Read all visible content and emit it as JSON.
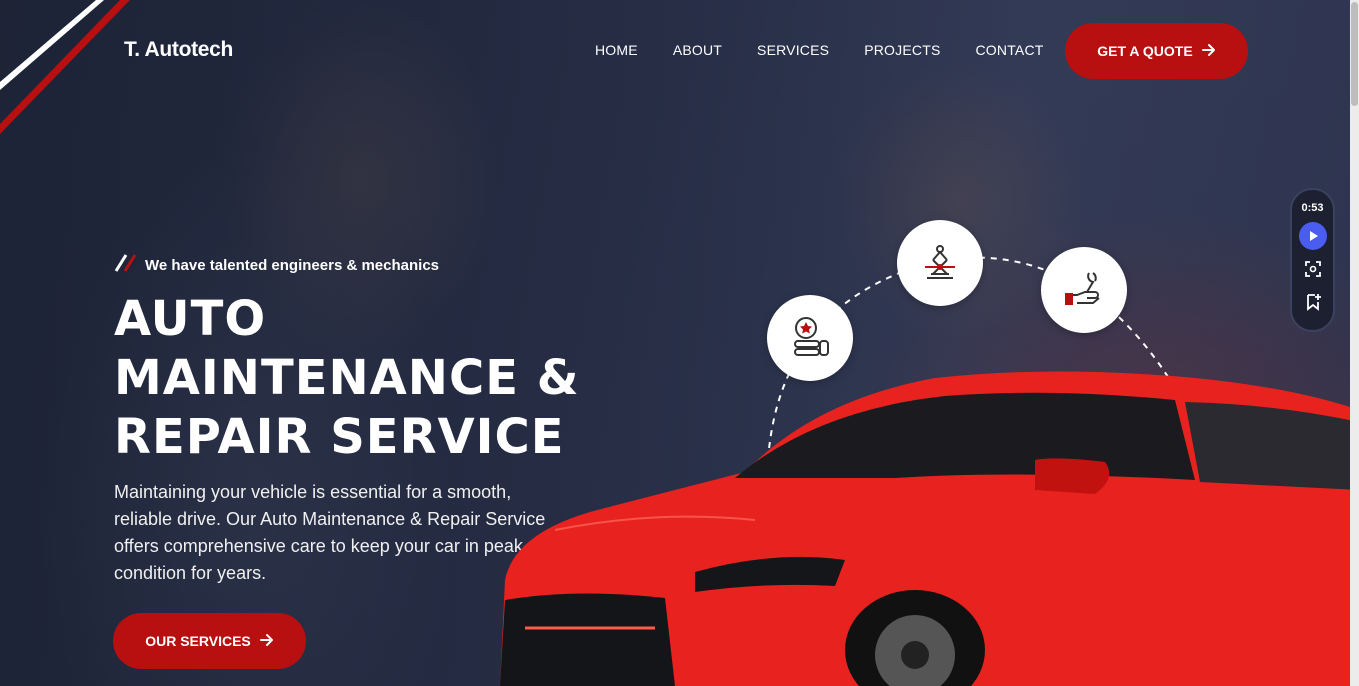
{
  "header": {
    "brand": "T. Autotech",
    "nav": [
      "HOME",
      "ABOUT",
      "SERVICES",
      "PROJECTS",
      "CONTACT"
    ],
    "quote_button": "GET A QUOTE"
  },
  "hero": {
    "tagline": "We have talented engineers & mechanics",
    "headline_lines": [
      "AUTO",
      "MAINTENANCE &",
      "REPAIR SERVICE"
    ],
    "description": "Maintaining your vehicle is essential for a smooth, reliable drive. Our Auto Maintenance & Repair Service offers comprehensive care to keep your car in peak condition for years.",
    "services_button": "OUR SERVICES"
  },
  "service_icons": [
    "tire-icon",
    "car-jack-icon",
    "wrench-hand-icon"
  ],
  "recorder": {
    "time": "0:53"
  },
  "colors": {
    "accent": "#b81010",
    "car": "#e8231f",
    "overlay": "#2a3146",
    "recorder_play": "#4b5df0"
  }
}
